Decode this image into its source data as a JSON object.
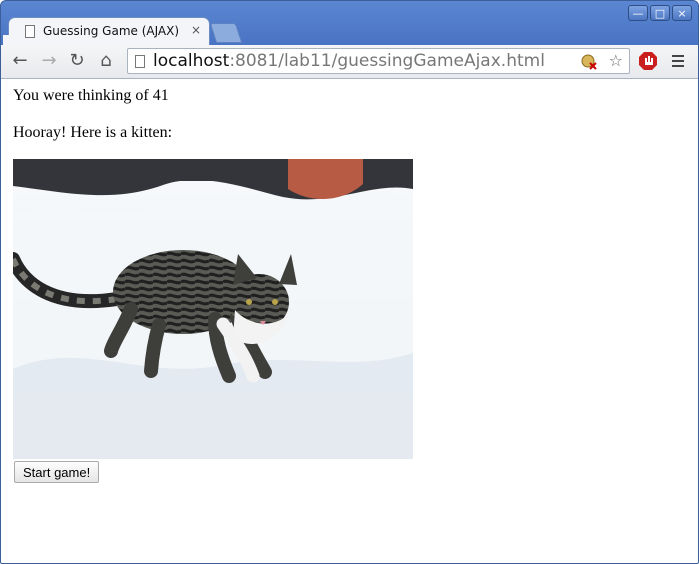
{
  "window_controls": [
    "—",
    "□",
    "×"
  ],
  "tab": {
    "title": "Guessing Game (AJAX)",
    "close": "×"
  },
  "toolbar": {
    "back_icon": "←",
    "forward_icon": "→",
    "reload_icon": "↻",
    "home_icon": "⌂"
  },
  "address": {
    "host": "localhost",
    "path": ":8081/lab11/guessingGameAjax.html",
    "star_icon": "☆"
  },
  "content": {
    "message": "You were thinking of 41",
    "celebration": "Hooray! Here is a kitten:",
    "button_label": "Start game!"
  }
}
